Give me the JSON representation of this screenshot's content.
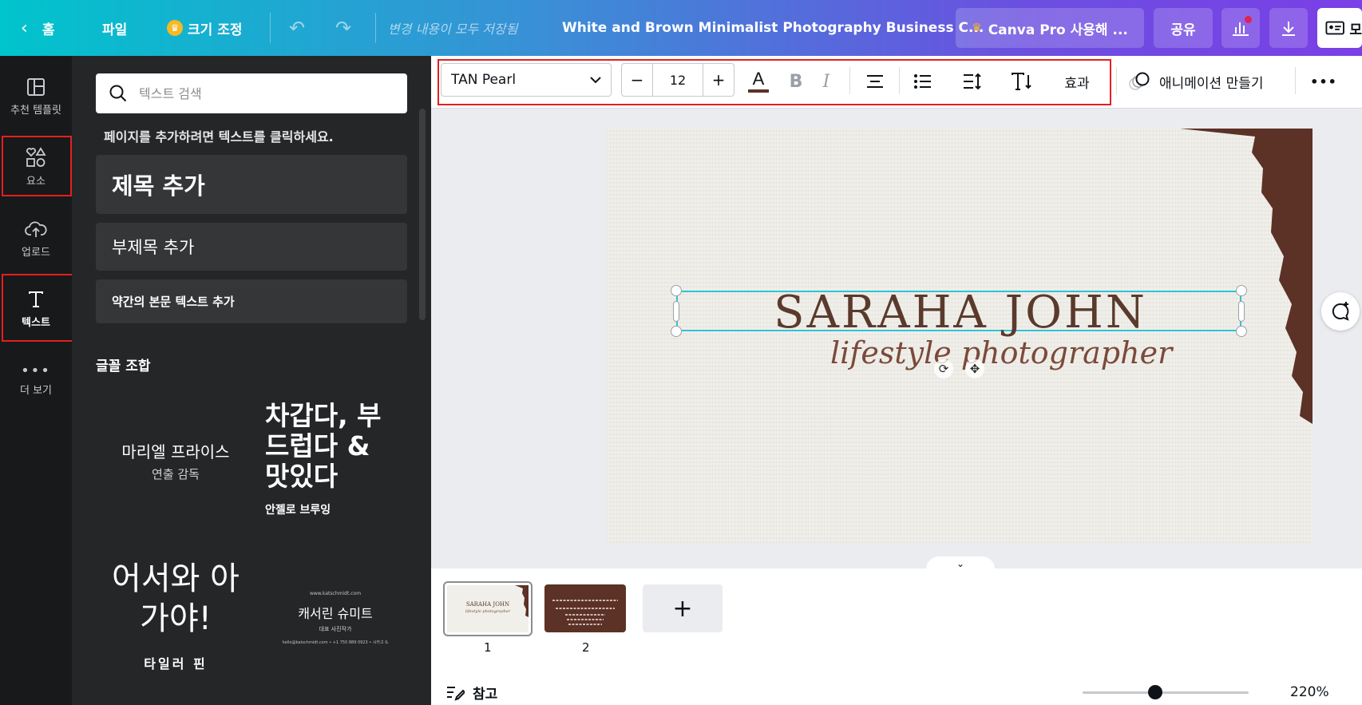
{
  "topbar": {
    "home": "홈",
    "file": "파일",
    "resize": "크기 조정",
    "save_status": "변경 내용이 모두 저장됨",
    "doc_title": "White and Brown Minimalist Photography Business C...",
    "pro": "Canva Pro 사용해 ...",
    "share": "공유",
    "trailing_char": "모"
  },
  "rail": {
    "items": [
      {
        "label": "추천 템플릿",
        "icon": "template-icon"
      },
      {
        "label": "요소",
        "icon": "elements-icon"
      },
      {
        "label": "업로드",
        "icon": "upload-icon"
      },
      {
        "label": "텍스트",
        "icon": "text-icon"
      },
      {
        "label": "더 보기",
        "icon": "more-icon"
      }
    ]
  },
  "panel": {
    "search_placeholder": "텍스트 검색",
    "hint": "페이지를 추가하려면 텍스트를 클릭하세요.",
    "add_heading": "제목 추가",
    "add_subheading": "부제목 추가",
    "add_body": "약간의 본문 텍스트 추가",
    "font_combos_title": "글꼴 조합",
    "combos": [
      {
        "main": "마리엘 프라이스",
        "sub": "연출 감독"
      },
      {
        "main": "차갑다, 부드럽다 & 맛있다",
        "sub": "안젤로 브루잉"
      },
      {
        "main": "어서와 아가야!",
        "sub": "타일러 핀"
      },
      {
        "main": "캐서린 슈미트",
        "sub": "대표 사진작가",
        "top": "www.katschmidt.com",
        "bottom": "hello@katschmidt.com • +1 750 889 0923 • 시카고 IL"
      }
    ]
  },
  "toolbar": {
    "font": "TAN Pearl",
    "decrease": "−",
    "size": "12",
    "increase": "+",
    "effects": "효과",
    "animate": "애니메이션 만들기",
    "more": "•••"
  },
  "design": {
    "title": "SARAHA JOHN",
    "subtitle": "lifestyle photographer",
    "accent_color": "#5c3126"
  },
  "pages": {
    "items": [
      "1",
      "2"
    ],
    "thumb1_title": "SARAHA JOHN",
    "thumb1_sub": "lifestyle photographer"
  },
  "footer": {
    "notes": "참고",
    "zoom": "220%",
    "zoom_level": 0.4
  }
}
